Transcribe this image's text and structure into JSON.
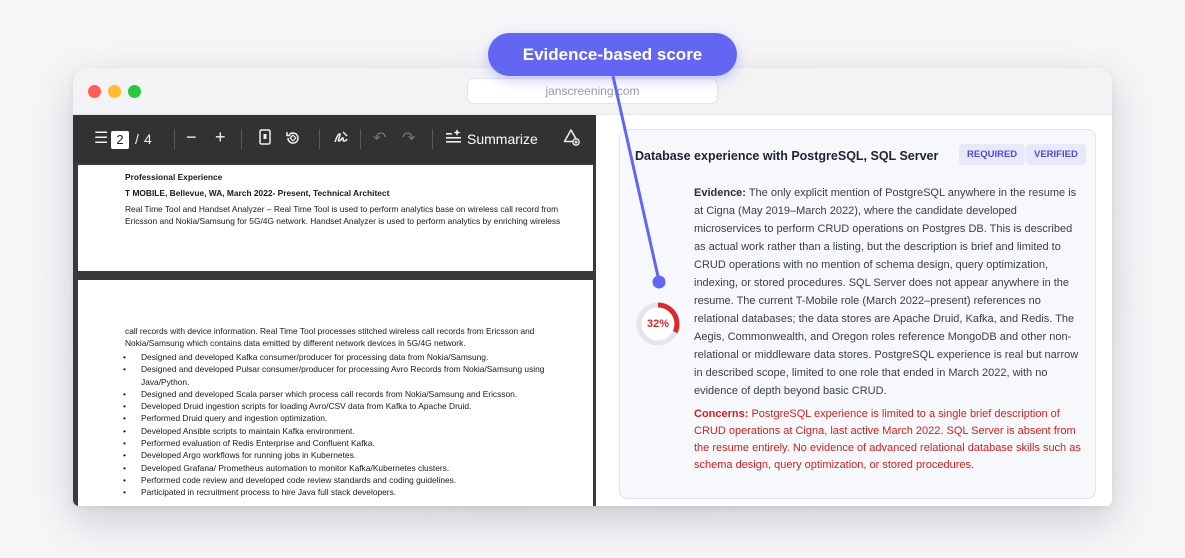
{
  "browser": {
    "url": "janscreening.com"
  },
  "callout": {
    "label": "Evidence-based score"
  },
  "pdf_toolbar": {
    "menu_icon": "menu-icon",
    "current_page": "2",
    "page_separator": "/",
    "total_pages": "4",
    "zoom_out": "−",
    "zoom_in": "+",
    "summarize_label": "Summarize"
  },
  "pdf": {
    "page1": {
      "heading": "Professional Experience",
      "job": "T MOBILE, Bellevue, WA, March 2022- Present, Technical Architect",
      "line1": "Real Time Tool and Handset Analyzer – Real Time Tool is used to perform analytics base on wireless call record from",
      "line2": "Ericsson and Nokia/Samsung for 5G/4G network. Handset Analyzer is used to perform analytics by enriching wireless"
    },
    "page2": {
      "line1": "call records with device information. Real Time Tool processes stitched wireless call records from Ericsson and",
      "line2": "Nokia/Samsung which contains data emitted by different network devices in 5G/4G network.",
      "bullets": [
        "Designed and developed Kafka consumer/producer for processing data from Nokia/Samsung.",
        "Designed and developed Pulsar consumer/producer for processing Avro Records from Nokia/Samsung using",
        "Java/Python.",
        "Designed and developed Scala parser which process call records from Nokia/Samsung and Ericsson.",
        "Developed Druid ingestion scripts for loading Avro/CSV data from Kafka to Apache Druid.",
        "Performed Druid query and ingestion optimization.",
        "Developed Ansible scripts to maintain Kafka environment.",
        "Performed evaluation of Redis Enterprise and Confluent Kafka.",
        "Developed Argo workflows for running jobs in Kubernetes.",
        "Developed Grafana/ Prometheus automation to monitor Kafka/Kubernetes clusters.",
        "Performed code review and developed code review standards and coding guidelines.",
        "Participated in recruitment process to hire Java full stack developers."
      ],
      "bullet_has_dot": [
        true,
        true,
        false,
        true,
        true,
        true,
        true,
        true,
        true,
        true,
        true,
        true
      ]
    }
  },
  "card": {
    "title": "Database experience with PostgreSQL, SQL Server",
    "badge_required": "REQUIRED",
    "badge_verified": "VERIFIED",
    "score": 32,
    "score_label": "32%",
    "evidence_label": "Evidence:",
    "evidence_text": " The only explicit mention of PostgreSQL anywhere in the resume is at Cigna (May 2019–March 2022), where the candidate developed microservices to perform CRUD operations on Postgres DB. This is described as actual work rather than a listing, but the description is brief and limited to CRUD operations with no mention of schema design, query optimization, indexing, or stored procedures. SQL Server does not appear anywhere in the resume. The current T-Mobile role (March 2022–present) references no relational databases; the data stores are Apache Druid, Kafka, and Redis. The Aegis, Commonwealth, and Oregon roles reference MongoDB and other non-relational or middleware data stores. PostgreSQL experience is real but narrow in described scope, limited to one role that ended in March 2022, with no evidence of depth beyond basic CRUD.",
    "concerns_label": "Concerns:",
    "concerns_text": " PostgreSQL experience is limited to a single brief description of CRUD operations at Cigna, last active March 2022. SQL Server is absent from the resume entirely. No evidence of advanced relational database skills such as schema design, query optimization, or stored procedures."
  },
  "colors": {
    "accent": "#6366f1",
    "score_red": "#d92b2b",
    "badge_bg": "#e7e8fa",
    "concerns": "#d11f1f"
  }
}
